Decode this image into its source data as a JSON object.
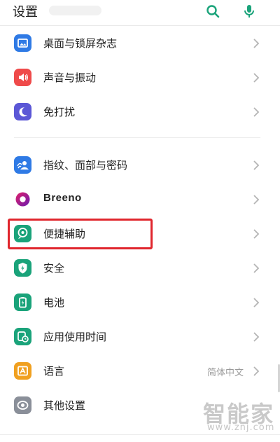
{
  "header": {
    "title": "设置",
    "search_icon": "search-icon",
    "mic_icon": "microphone-icon",
    "accent_color": "#1aa37a"
  },
  "group1": [
    {
      "label": "桌面与锁屏杂志",
      "icon": "wallpaper-icon",
      "color": "#2f7ae5"
    },
    {
      "label": "声音与振动",
      "icon": "speaker-icon",
      "color": "#ef4a4a"
    },
    {
      "label": "免打扰",
      "icon": "moon-icon",
      "color": "#5b57d6"
    }
  ],
  "group2": [
    {
      "label": "指纹、面部与密码",
      "icon": "fingerprint-face-icon",
      "color": "#2f7ae5"
    },
    {
      "label": "Breeno",
      "icon": "breeno-icon",
      "color": "#a21e8d"
    },
    {
      "label": "便捷辅助",
      "icon": "assist-icon",
      "color": "#1aa37a",
      "highlighted": true
    },
    {
      "label": "安全",
      "icon": "shield-icon",
      "color": "#1aa37a"
    },
    {
      "label": "电池",
      "icon": "battery-icon",
      "color": "#1aa37a"
    },
    {
      "label": "应用使用时间",
      "icon": "app-usage-icon",
      "color": "#1aa37a"
    },
    {
      "label": "语言",
      "icon": "language-icon",
      "color": "#f0a020",
      "value": "简体中文"
    },
    {
      "label": "其他设置",
      "icon": "more-settings-icon",
      "color": "#8a8f99"
    }
  ],
  "watermark": {
    "text": "智能家",
    "url": "www.znj.com"
  },
  "highlight_color": "#e0262d"
}
